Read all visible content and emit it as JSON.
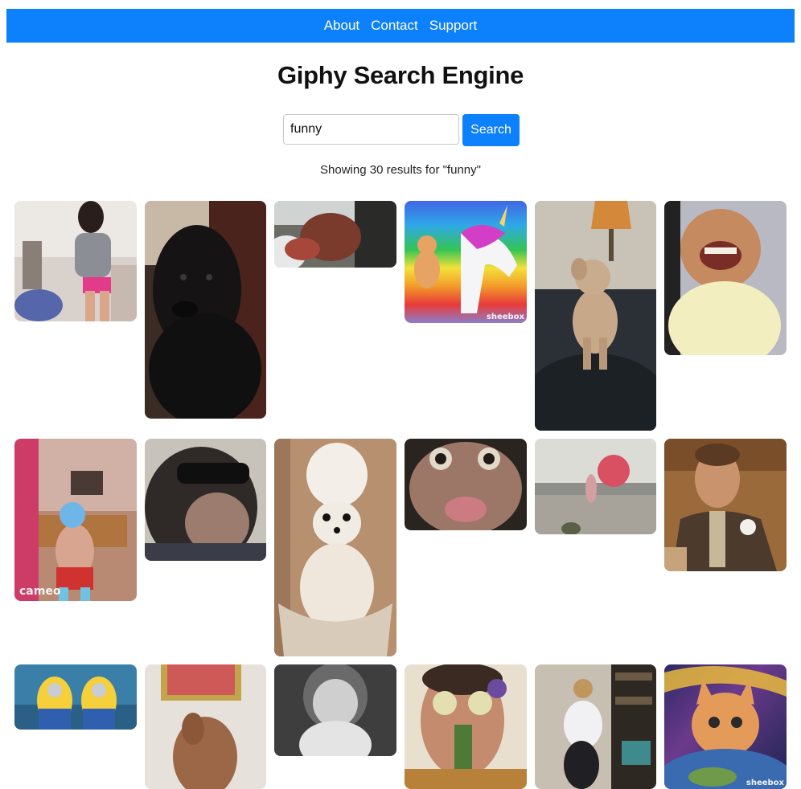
{
  "nav": {
    "links": [
      "About",
      "Contact",
      "Support"
    ]
  },
  "page": {
    "title": "Giphy Search Engine"
  },
  "search": {
    "value": "funny",
    "button_label": "Search"
  },
  "results": {
    "summary": "Showing 30 results for \"funny\""
  },
  "watermarks": {
    "sheebox": "sheebox",
    "cameo": "cameo"
  },
  "gifs": [
    {
      "name": "gif-woman-dancing",
      "subject": "woman dancing in tank top"
    },
    {
      "name": "gif-black-dog-staring",
      "subject": "black dog staring"
    },
    {
      "name": "gif-dog-car-window",
      "subject": "dog face at car window"
    },
    {
      "name": "gif-cat-riding-unicorn",
      "subject": "cat riding unicorn over rainbow"
    },
    {
      "name": "gif-poodle-on-couch",
      "subject": "poodle sitting on couch"
    },
    {
      "name": "gif-laughing-kid",
      "subject": "laughing kid"
    },
    {
      "name": "gif-luchador-dancing",
      "subject": "luchador dancing in living room"
    },
    {
      "name": "gif-chimp-sunglasses",
      "subject": "chimp with sunglasses"
    },
    {
      "name": "gif-chihuahua-towel",
      "subject": "chihuahua with towel on head"
    },
    {
      "name": "gif-monkey-close-up",
      "subject": "monkey close-up face"
    },
    {
      "name": "gif-kid-with-ball",
      "subject": "kid with ball"
    },
    {
      "name": "gif-dicaprio-laughing",
      "subject": "man in suit laughing"
    },
    {
      "name": "gif-minions",
      "subject": "minions"
    },
    {
      "name": "gif-dog-jumping",
      "subject": "dog jumping"
    },
    {
      "name": "gif-shirley-laughing",
      "subject": "girl laughing black and white"
    },
    {
      "name": "gif-cucumber-eyes",
      "subject": "man with cucumber eyes"
    },
    {
      "name": "gif-woman-dancing-kitchen",
      "subject": "woman dancing"
    },
    {
      "name": "gif-space-cat",
      "subject": "cat in space above earth"
    }
  ]
}
